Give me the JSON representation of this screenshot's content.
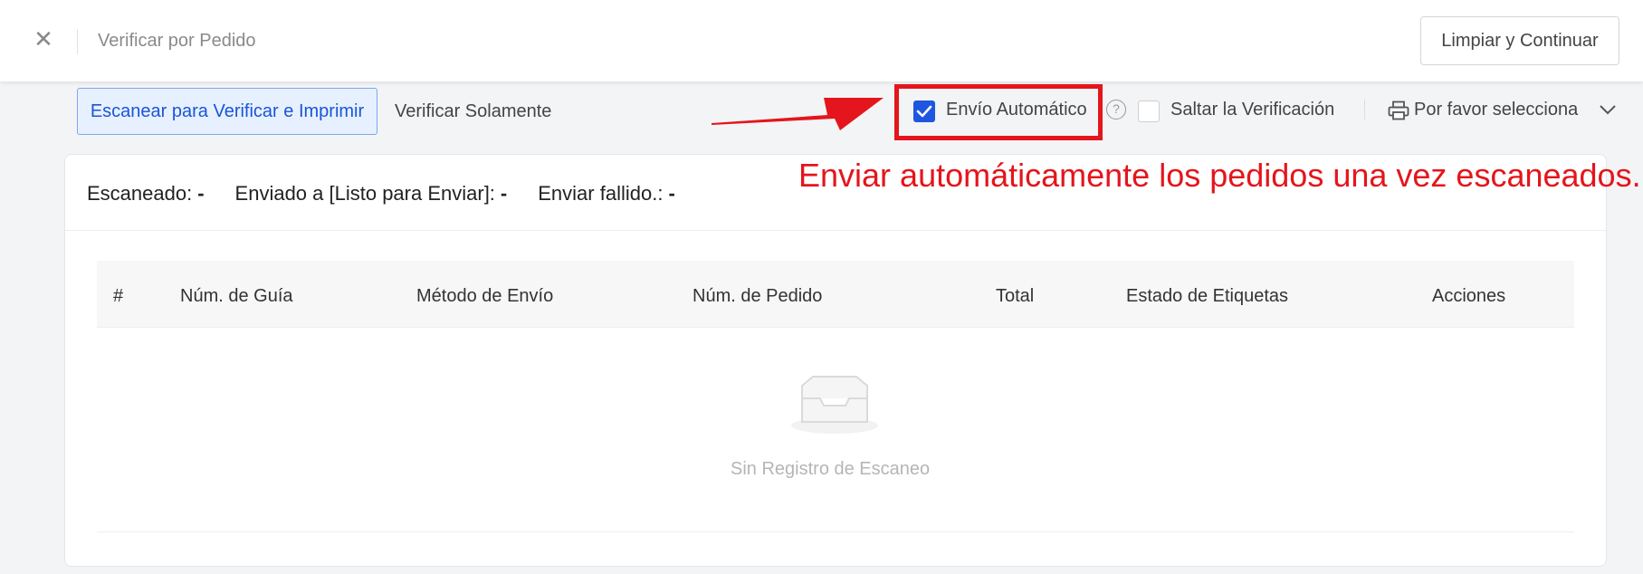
{
  "header": {
    "title": "Verificar por Pedido",
    "close_icon": "close-icon",
    "clear_button": "Limpiar y Continuar"
  },
  "tabs": [
    {
      "label": "Escanear para Verificar e Imprimir",
      "active": true
    },
    {
      "label": "Verificar Solamente",
      "active": false
    }
  ],
  "options": {
    "auto_ship": {
      "label": "Envío Automático",
      "checked": true
    },
    "skip_verify": {
      "label": "Saltar la Verificación",
      "checked": false
    },
    "printer": {
      "placeholder": "Por favor selecciona",
      "icon": "printer-icon"
    }
  },
  "annotation": {
    "text": "Enviar automáticamente los pedidos una vez escaneados.",
    "color": "#e4151c"
  },
  "stats": [
    {
      "label": "Escaneado:",
      "value": "-"
    },
    {
      "label": "Enviado a [Listo para Enviar]:",
      "value": "-"
    },
    {
      "label": "Enviar fallido.:",
      "value": "-"
    }
  ],
  "table": {
    "columns": [
      "#",
      "Núm. de Guía",
      "Método de Envío",
      "Núm. de Pedido",
      "Total",
      "Estado de Etiquetas",
      "Acciones"
    ],
    "rows": []
  },
  "empty_state": {
    "text": "Sin Registro de Escaneo",
    "icon": "inbox-icon"
  },
  "colors": {
    "accent": "#1f56e0",
    "highlight": "#e4151c"
  }
}
